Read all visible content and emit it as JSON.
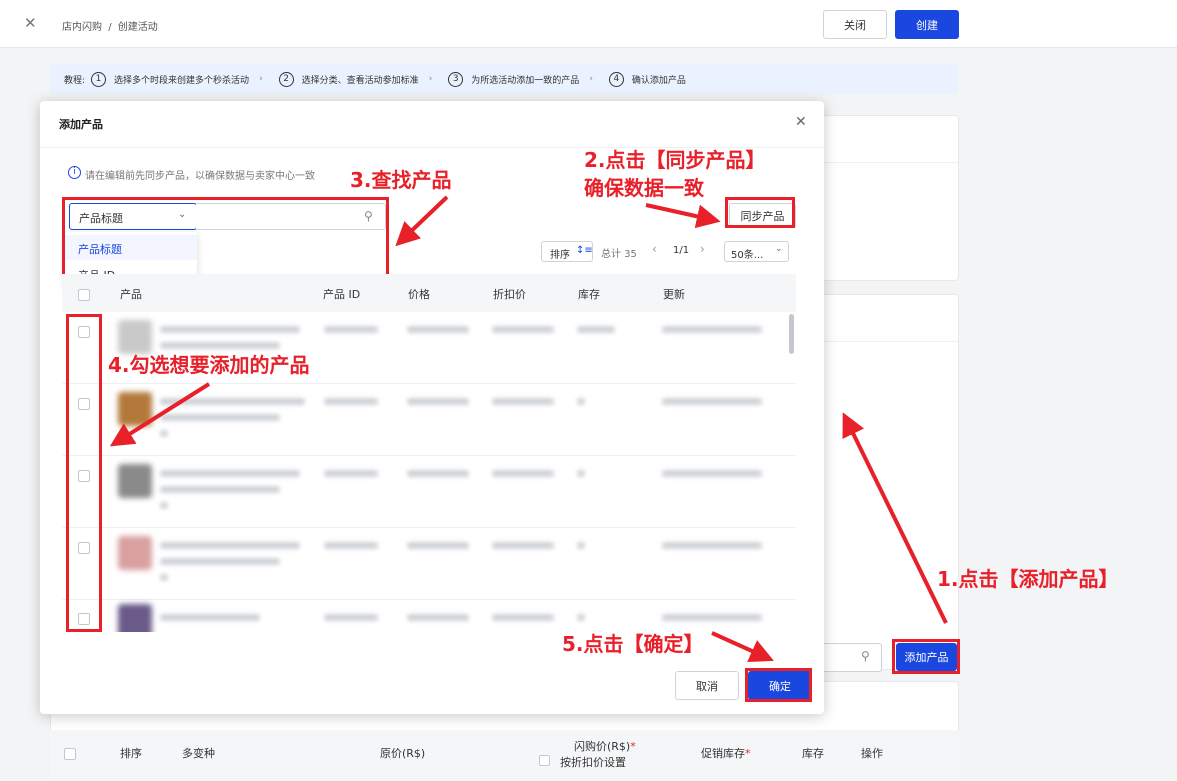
{
  "header": {
    "breadcrumb_root": "店内闪购",
    "breadcrumb_sep": "/",
    "breadcrumb_current": "创建活动",
    "close_label": "关闭",
    "create_label": "创建"
  },
  "tutorial": {
    "prefix": "教程:",
    "steps": [
      {
        "num": "1",
        "text": "选择多个时段来创建多个秒杀活动"
      },
      {
        "num": "2",
        "text": "选择分类、查看活动参加标准"
      },
      {
        "num": "3",
        "text": "为所选活动添加一致的产品"
      },
      {
        "num": "4",
        "text": "确认添加产品"
      }
    ]
  },
  "modal": {
    "title": "添加产品",
    "info": "请在编辑前先同步产品，以确保数据与卖家中心一致",
    "search_type_selected": "产品标题",
    "search_options": [
      "产品标题",
      "产品 ID"
    ],
    "sync_label": "同步产品",
    "sort_label": "排序",
    "total_label": "总计 35",
    "page": "1/1",
    "page_size": "50条...",
    "columns": [
      "产品",
      "产品 ID",
      "价格",
      "折扣价",
      "库存",
      "更新"
    ],
    "cancel_label": "取消",
    "confirm_label": "确定"
  },
  "annotations": {
    "step1": "1.点击【添加产品】",
    "step2_line1": "2.点击【同步产品】",
    "step2_line2": "确保数据一致",
    "step3": "3.查找产品",
    "step4": "4.勾选想要添加的产品",
    "step5": "5.点击【确定】"
  },
  "background": {
    "add_product_label": "添加产品",
    "columns": {
      "sort": "排序",
      "variants": "多变种",
      "original_price": "原价(R$)",
      "flash_price": "闪购价(R$)",
      "discount_setting": "按折扣价设置",
      "promo_stock": "促销库存",
      "stock": "库存",
      "actions": "操作"
    }
  },
  "colors": {
    "accent": "#1a47e0",
    "annotation_red": "#e8202a",
    "tutorial_bg": "#e9f2fe"
  }
}
